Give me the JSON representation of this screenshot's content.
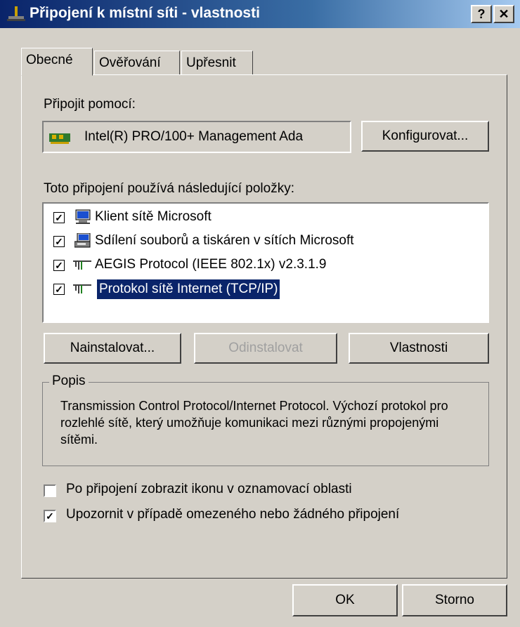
{
  "window": {
    "title": "Připojení k místní síti - vlastnosti",
    "help_label": "?",
    "close_label": "✕"
  },
  "tabs": [
    {
      "label": "Obecné",
      "active": true
    },
    {
      "label": "Ověřování",
      "active": false
    },
    {
      "label": "Upřesnit",
      "active": false
    }
  ],
  "connect_using": {
    "label": "Připojit pomocí:",
    "adapter": "Intel(R) PRO/100+ Management Ada",
    "configure_label": "Konfigurovat..."
  },
  "components": {
    "label": "Toto připojení používá následující položky:",
    "items": [
      {
        "label": "Klient sítě Microsoft",
        "checked": true,
        "icon": "network-client-icon"
      },
      {
        "label": "Sdílení souborů a tiskáren v sítích Microsoft",
        "checked": true,
        "icon": "file-printer-sharing-icon"
      },
      {
        "label": "AEGIS Protocol (IEEE 802.1x) v2.3.1.9",
        "checked": true,
        "icon": "protocol-icon"
      },
      {
        "label": "Protokol sítě Internet (TCP/IP)",
        "checked": true,
        "icon": "protocol-icon",
        "selected": true
      }
    ]
  },
  "actions": {
    "install": "Nainstalovat...",
    "uninstall": "Odinstalovat",
    "properties": "Vlastnosti"
  },
  "description": {
    "legend": "Popis",
    "text": "Transmission Control Protocol/Internet Protocol. Výchozí protokol pro rozlehlé sítě, který umožňuje komunikaci mezi různými propojenými sítěmi."
  },
  "options": [
    {
      "label": "Po připojení zobrazit ikonu v oznamovací oblasti",
      "checked": false
    },
    {
      "label": "Upozornit v případě omezeného nebo žádného připojení",
      "checked": true
    }
  ],
  "footer": {
    "ok": "OK",
    "cancel": "Storno"
  },
  "colors": {
    "title_bar": "#0a246a",
    "dialog_bg": "#d4d0c8",
    "selection": "#0a246a"
  }
}
